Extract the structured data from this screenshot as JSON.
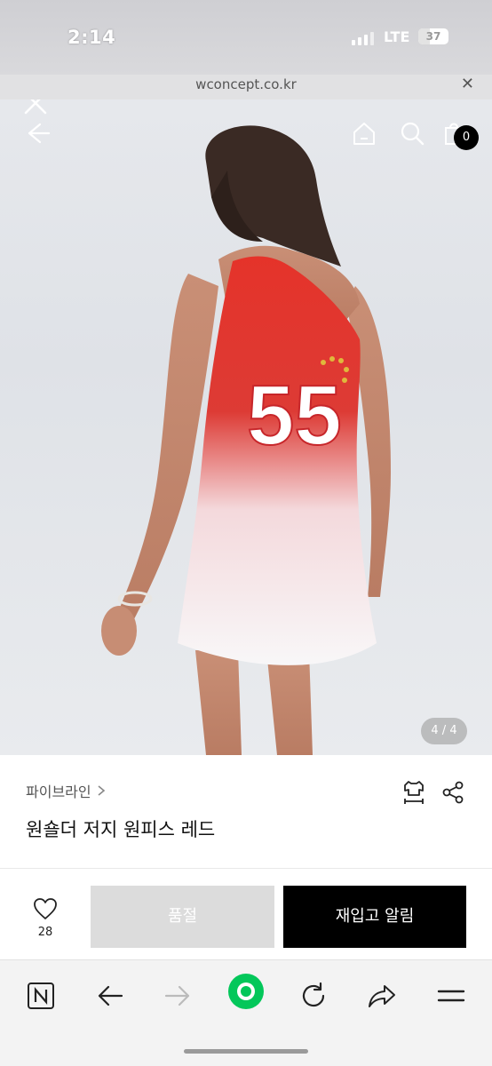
{
  "status_bar": {
    "time": "2:14",
    "network": "LTE",
    "battery": "37"
  },
  "url_bar": {
    "url": "wconcept.co.kr"
  },
  "hero": {
    "cart_count": "0",
    "image_counter": "4 / 4",
    "jersey_number": "55"
  },
  "product": {
    "brand": "파이브라인",
    "title": "원숄더 저지 원피스 레드"
  },
  "actions": {
    "like_count": "28",
    "soldout_label": "품절",
    "restock_label": "재입고 알림"
  },
  "colors": {
    "accent": "#000000",
    "dress_red": "#e5332a",
    "soldout_bg": "#dcdcdc",
    "naver_green": "#03c75a"
  },
  "icons": {
    "close": "close-icon",
    "back": "back-arrow-icon",
    "home": "home-icon",
    "search": "search-icon",
    "cart": "shopping-bag-icon",
    "size": "size-guide-icon",
    "share": "share-icon",
    "heart": "heart-icon"
  }
}
